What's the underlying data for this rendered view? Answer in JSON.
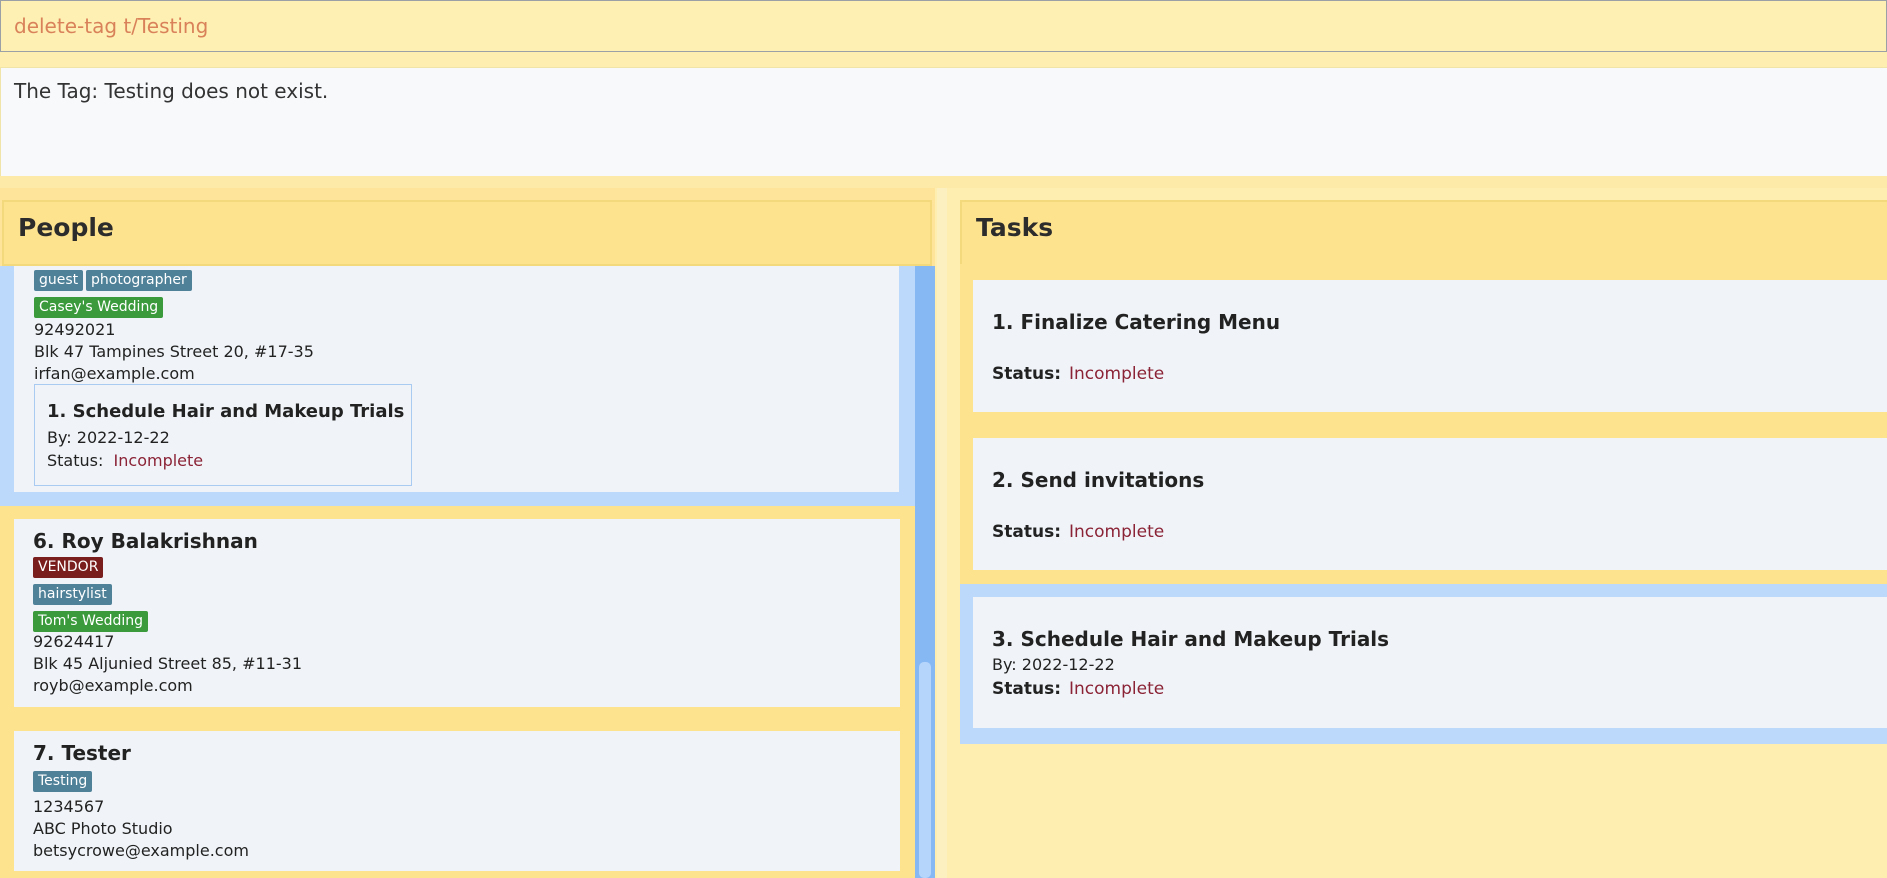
{
  "command": {
    "value": "delete-tag t/Testing"
  },
  "result": {
    "message": "The Tag: Testing does not exist."
  },
  "people_panel": {
    "title": "People",
    "persons": [
      {
        "tags": [
          "guest",
          "photographer"
        ],
        "wedding": "Casey's Wedding",
        "phone": "92492021",
        "address": "Blk 47 Tampines Street 20, #17-35",
        "email": "irfan@example.com",
        "task": {
          "title": "1.  Schedule Hair and Makeup Trials",
          "by": "By: 2022-12-22",
          "status_label": "Status:",
          "status_value": "Incomplete"
        }
      },
      {
        "name": "6.  Roy Balakrishnan",
        "role": "VENDOR",
        "tags": [
          "hairstylist"
        ],
        "wedding": "Tom's Wedding",
        "phone": "92624417",
        "address": "Blk 45 Aljunied Street 85, #11-31",
        "email": "royb@example.com"
      },
      {
        "name": "7.  Tester",
        "tags": [
          "Testing"
        ],
        "phone": "1234567",
        "address": "ABC Photo Studio",
        "email": "betsycrowe@example.com"
      }
    ]
  },
  "tasks_panel": {
    "title": "Tasks",
    "tasks": [
      {
        "title": "1.  Finalize Catering Menu",
        "status_label": "Status:",
        "status_value": "Incomplete"
      },
      {
        "title": "2.  Send invitations",
        "status_label": "Status:",
        "status_value": "Incomplete"
      },
      {
        "title": "3.  Schedule Hair and Makeup Trials",
        "by": "By: 2022-12-22",
        "status_label": "Status:",
        "status_value": "Incomplete"
      }
    ]
  },
  "colors": {
    "incomplete": "#8b2336",
    "role_tag": "#4f8199",
    "wedding_tag": "#3a9a3c",
    "vendor_tag": "#7a1d1d",
    "selected": "#bcd9fb"
  }
}
